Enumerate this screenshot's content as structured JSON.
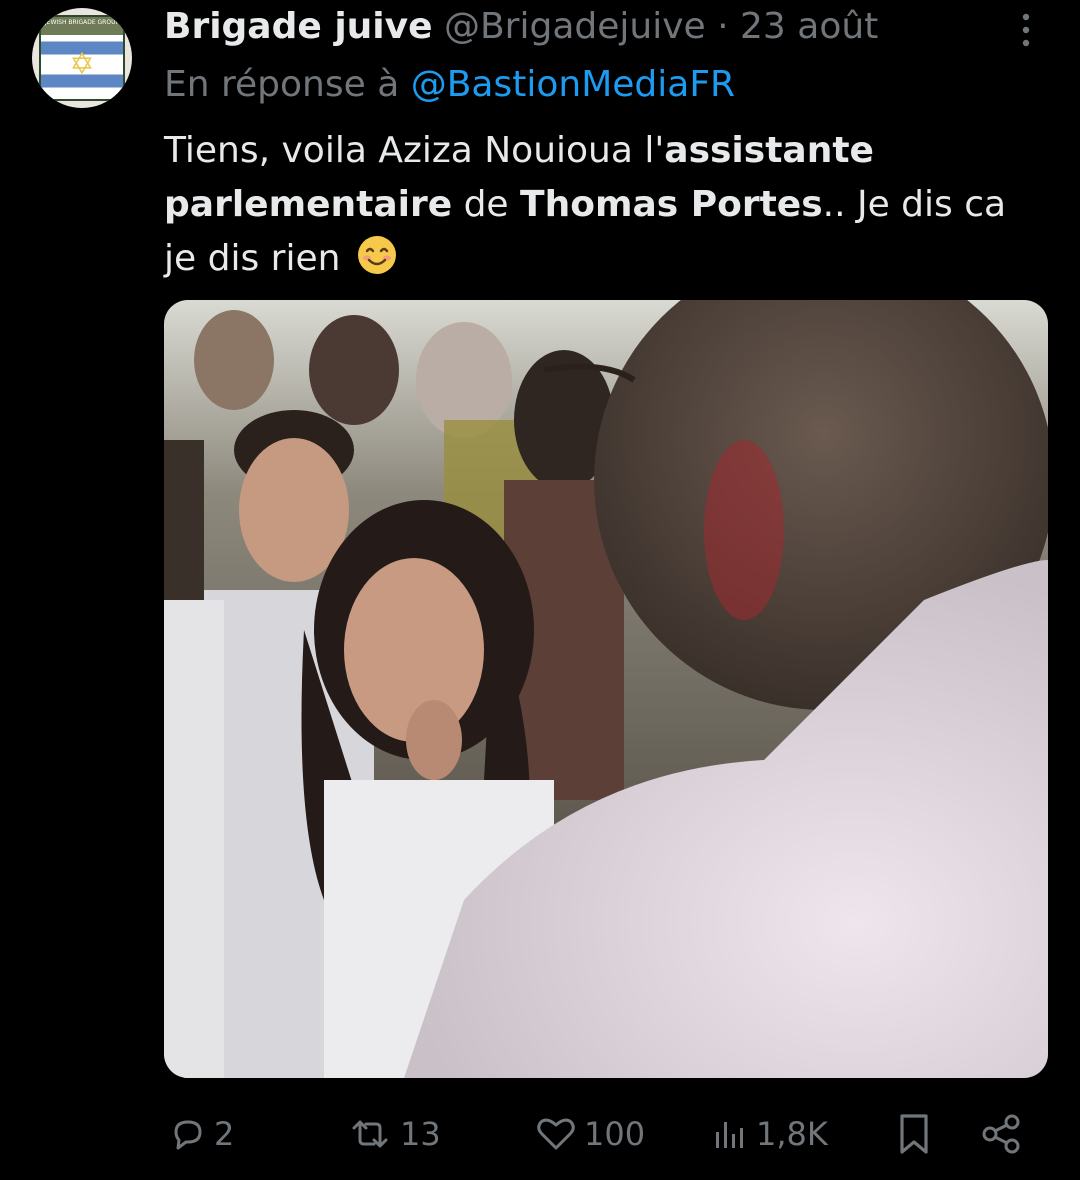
{
  "tweet": {
    "author_name": "Brigade juive",
    "handle": "@Brigadejuive",
    "separator": "·",
    "date": "23 août",
    "avatar": {
      "badge_text": "JEWISH BRIGADE GROUP",
      "icon": "star-of-david-icon"
    },
    "reply_prefix": "En réponse à",
    "reply_to": "@BastionMediaFR",
    "text_segments": [
      {
        "text": "Tiens, voila Aziza Nouioua l'",
        "bold": false
      },
      {
        "text": "assistante parlementaire",
        "bold": true
      },
      {
        "text": " de ",
        "bold": false
      },
      {
        "text": "Thomas Portes",
        "bold": true
      },
      {
        "text": ".. Je dis ca je dis rien",
        "bold": false
      }
    ],
    "emoji": "smiling-face-icon",
    "media": {
      "kind": "video-still",
      "description_icon": "photo"
    }
  },
  "actions": {
    "replies": {
      "icon": "reply-icon",
      "count": "2"
    },
    "reposts": {
      "icon": "repost-icon",
      "count": "13"
    },
    "likes": {
      "icon": "heart-icon",
      "count": "100"
    },
    "views": {
      "icon": "views-icon",
      "count": "1,8K"
    },
    "bookmark": {
      "icon": "bookmark-icon"
    },
    "share": {
      "icon": "share-icon"
    }
  },
  "colors": {
    "background": "#000000",
    "primary_text": "#e7e9ea",
    "secondary_text": "#71767b",
    "link": "#1d9bf0"
  }
}
